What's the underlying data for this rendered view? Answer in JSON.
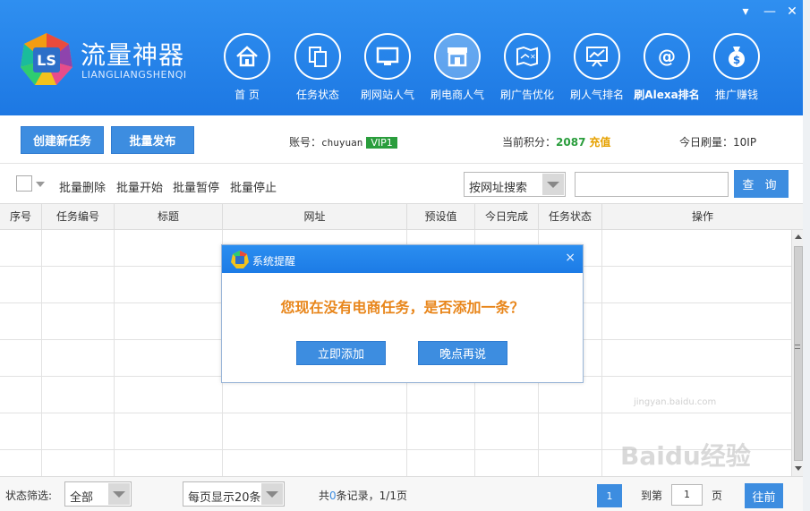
{
  "app": {
    "name_cn": "流量神器",
    "name_en": "LIANGLIANGSHENQI"
  },
  "window_controls": {
    "menu": "▾",
    "minimize": "—",
    "close": "✕"
  },
  "nav": {
    "items": [
      {
        "label": "首 页",
        "icon": "home-icon"
      },
      {
        "label": "任务状态",
        "icon": "documents-icon"
      },
      {
        "label": "刷网站人气",
        "icon": "monitor-icon"
      },
      {
        "label": "刷电商人气",
        "icon": "store-icon",
        "active": true
      },
      {
        "label": "刷广告优化",
        "icon": "map-icon"
      },
      {
        "label": "刷人气排名",
        "icon": "presentation-chart-icon"
      },
      {
        "label": "刷Alexa排名",
        "icon": "at-sign-icon"
      },
      {
        "label": "推广赚钱",
        "icon": "money-bag-icon"
      }
    ]
  },
  "actions": {
    "create_task": "创建新任务",
    "batch_publish": "批量发布"
  },
  "account": {
    "label": "账号：",
    "username": "chuyuan",
    "vip": "VIP1",
    "points_label": "当前积分：",
    "points": "2087",
    "recharge": "充值",
    "today_label": "今日刷量：",
    "today_value": "10IP"
  },
  "toolbar": {
    "batch_delete": "批量删除",
    "batch_start": "批量开始",
    "batch_pause": "批量暂停",
    "batch_stop": "批量停止",
    "search_mode": "按网址搜索",
    "search_value": "",
    "query": "查 询"
  },
  "table": {
    "columns": [
      "序号",
      "任务编号",
      "标题",
      "网址",
      "预设值",
      "今日完成",
      "任务状态",
      "操作"
    ],
    "rows": []
  },
  "footer": {
    "status_filter_label": "状态筛选:",
    "status_filter_value": "全部",
    "page_size": "每页显示20条",
    "records_prefix": "共",
    "records_count": "0",
    "records_suffix": "条记录，1/1页",
    "current_page": "1",
    "goto_label": "到第",
    "goto_value": "1",
    "page_unit": "页",
    "go": "往前"
  },
  "dialog": {
    "title": "系统提醒",
    "close": "×",
    "message": "您现在没有电商任务，是否添加一条？",
    "confirm": "立即添加",
    "later": "晚点再说"
  },
  "watermark": {
    "main": "Baidu经验",
    "sub": "jingyan.baidu.com"
  },
  "colors": {
    "header": "#1d78e3",
    "button": "#3d8de0",
    "vip": "#2a9d3c",
    "points": "#2a9d3c",
    "recharge": "#e6a100",
    "dialog_message": "#e8861b"
  }
}
